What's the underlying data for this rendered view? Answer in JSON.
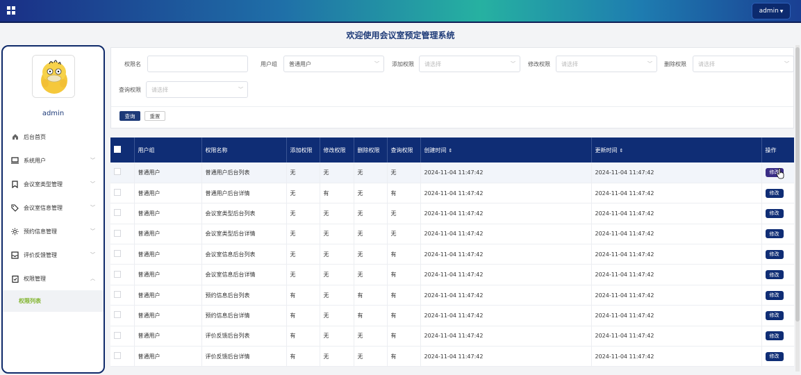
{
  "header": {
    "user_label": "admin",
    "title": "欢迎使用会议室预定管理系统"
  },
  "sidebar": {
    "username": "admin",
    "items": [
      {
        "label": "后台首页",
        "icon": "home-icon"
      },
      {
        "label": "系统用户",
        "icon": "monitor-icon"
      },
      {
        "label": "会议室类型管理",
        "icon": "bookmark-icon"
      },
      {
        "label": "会议室信息管理",
        "icon": "tag-icon"
      },
      {
        "label": "预约信息管理",
        "icon": "sun-icon"
      },
      {
        "label": "评价反馈管理",
        "icon": "inbox-icon"
      },
      {
        "label": "权限管理",
        "icon": "clipboard-check-icon"
      }
    ],
    "active_sub": "权限列表"
  },
  "filter": {
    "perm_name_label": "权限名",
    "perm_name_value": "",
    "user_group_label": "用户组",
    "user_group_value": "普通用户",
    "add_perm_label": "添加权限",
    "add_perm_placeholder": "请选择",
    "edit_perm_label": "修改权限",
    "edit_perm_placeholder": "请选择",
    "delete_perm_label": "删除权限",
    "delete_perm_placeholder": "请选择",
    "query_perm_label": "查询权限",
    "query_perm_placeholder": "请选择",
    "search_button": "查询",
    "reset_button": "重置"
  },
  "table": {
    "headers": [
      "用户组",
      "权限名称",
      "添加权限",
      "修改权限",
      "删除权限",
      "查询权限",
      "创建时间",
      "更新时间",
      "操作"
    ],
    "edit_label": "修改",
    "rows": [
      [
        "普通用户",
        "普通用户后台列表",
        "无",
        "无",
        "无",
        "无",
        "2024-11-04 11:47:42",
        "2024-11-04 11:47:42"
      ],
      [
        "普通用户",
        "普通用户后台详情",
        "无",
        "有",
        "无",
        "有",
        "2024-11-04 11:47:42",
        "2024-11-04 11:47:42"
      ],
      [
        "普通用户",
        "会议室类型后台列表",
        "无",
        "无",
        "无",
        "无",
        "2024-11-04 11:47:42",
        "2024-11-04 11:47:42"
      ],
      [
        "普通用户",
        "会议室类型后台详情",
        "无",
        "无",
        "无",
        "无",
        "2024-11-04 11:47:42",
        "2024-11-04 11:47:42"
      ],
      [
        "普通用户",
        "会议室信息后台列表",
        "无",
        "无",
        "无",
        "有",
        "2024-11-04 11:47:42",
        "2024-11-04 11:47:42"
      ],
      [
        "普通用户",
        "会议室信息后台详情",
        "无",
        "无",
        "无",
        "有",
        "2024-11-04 11:47:42",
        "2024-11-04 11:47:42"
      ],
      [
        "普通用户",
        "预约信息后台列表",
        "有",
        "无",
        "有",
        "有",
        "2024-11-04 11:47:42",
        "2024-11-04 11:47:42"
      ],
      [
        "普通用户",
        "预约信息后台详情",
        "有",
        "无",
        "有",
        "有",
        "2024-11-04 11:47:42",
        "2024-11-04 11:47:42"
      ],
      [
        "普通用户",
        "评价反馈后台列表",
        "有",
        "无",
        "无",
        "有",
        "2024-11-04 11:47:42",
        "2024-11-04 11:47:42"
      ],
      [
        "普通用户",
        "评价反馈后台详情",
        "有",
        "无",
        "无",
        "有",
        "2024-11-04 11:47:42",
        "2024-11-04 11:47:42"
      ]
    ]
  }
}
